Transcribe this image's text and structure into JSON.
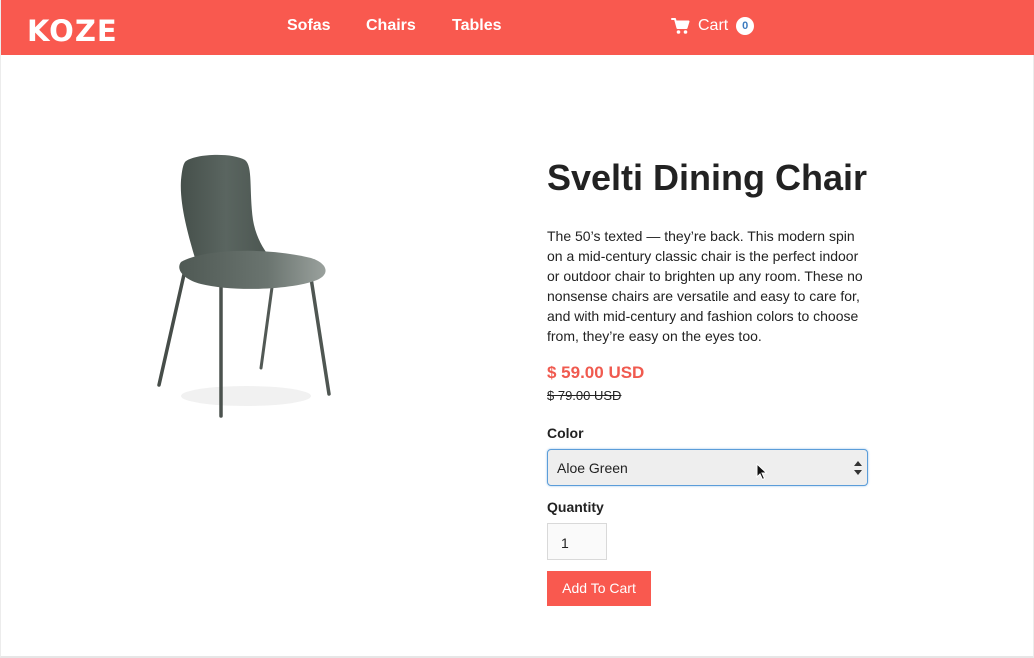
{
  "header": {
    "logo": "KOZE",
    "nav": [
      "Sofas",
      "Chairs",
      "Tables"
    ],
    "cart_label": "Cart",
    "cart_count": "0"
  },
  "colors": {
    "brand": "#f9594f",
    "price": "#f05a4f",
    "chair_shell": "#5b6660",
    "focus_border": "#5b9dd9"
  },
  "icons": {
    "cart": "shopping-cart-icon",
    "select": "select-arrows-icon",
    "cursor": "mouse-pointer-icon"
  },
  "product": {
    "image_name": "chair-image",
    "title": "Svelti Dining Chair",
    "description": "The 50’s texted — they’re back. This modern spin on a mid-century classic chair is the perfect indoor or outdoor chair to brighten up any room. These no nonsense chairs are versatile and easy to care for, and with mid-century and fashion colors to choose from, they’re easy on the eyes too.",
    "price": "$ 59.00 USD",
    "compare_at_price": "$ 79.00 USD",
    "color_label": "Color",
    "color_selected": "Aloe Green",
    "quantity_label": "Quantity",
    "quantity_value": "1",
    "add_to_cart_label": "Add To Cart"
  }
}
